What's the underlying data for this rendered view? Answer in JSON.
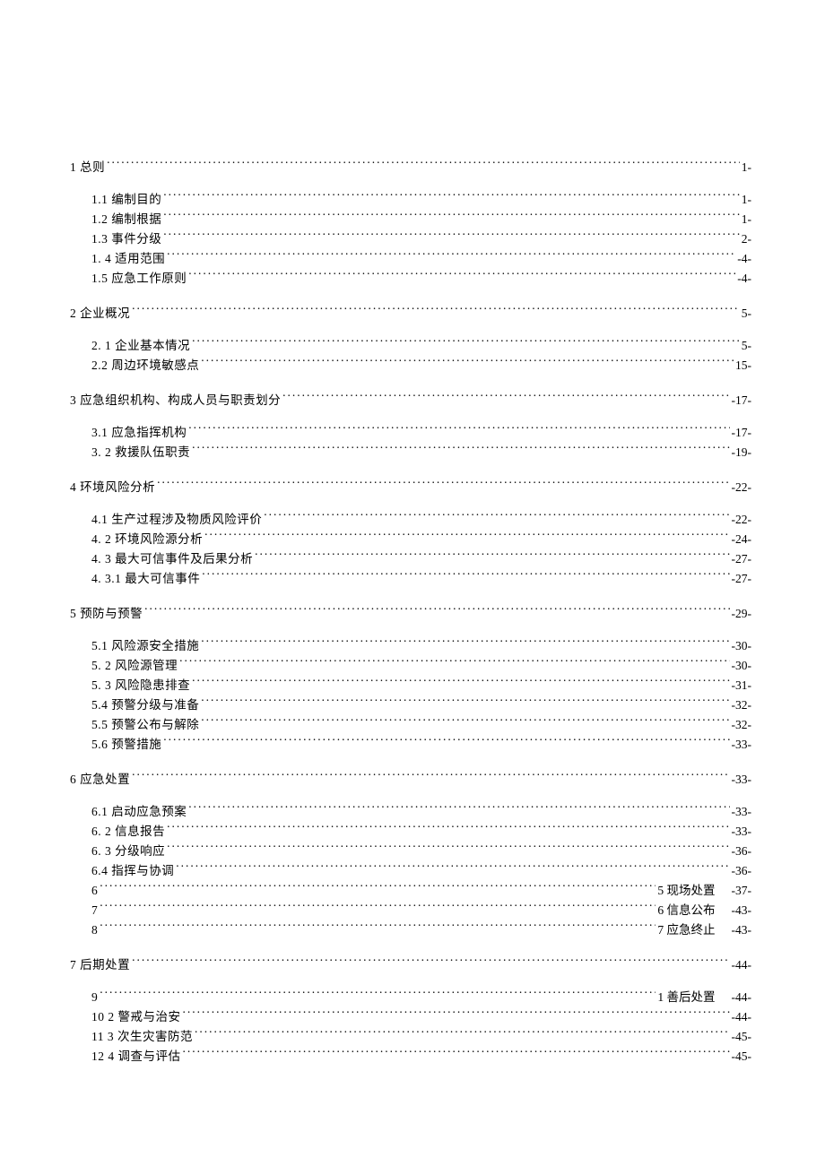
{
  "toc": [
    {
      "head": {
        "label": "1 总则",
        "page": "1-"
      },
      "items": [
        {
          "label": "1.1 编制目的",
          "page": "1-"
        },
        {
          "label": "1.2  编制根据",
          "page": "1-"
        },
        {
          "label": "1.3  事件分级",
          "page": "2-"
        },
        {
          "label": "1. 4 适用范围",
          "page": "-4-"
        },
        {
          "label": "1.5 应急工作原则",
          "page": "-4-"
        }
      ]
    },
    {
      "head": {
        "label": "2    企业概况",
        "page": "5-"
      },
      "items": [
        {
          "label": "2. 1 企业基本情况",
          "page": "5-"
        },
        {
          "label": "2.2 周边环境敏感点",
          "page": "15-"
        }
      ]
    },
    {
      "head": {
        "label": "3    应急组织机构、构成人员与职责划分",
        "page": "-17-"
      },
      "items": [
        {
          "label": "3.1  应急指挥机构",
          "page": "-17-"
        },
        {
          "label": "3. 2 救援队伍职责",
          "page": "-19-"
        }
      ]
    },
    {
      "head": {
        "label": "4    环境风险分析",
        "page": "-22-"
      },
      "items": [
        {
          "label": "4.1  生产过程涉及物质风险评价",
          "page": "-22-"
        },
        {
          "label": "4. 2 环境风险源分析",
          "page": "-24-"
        },
        {
          "label": "4. 3 最大可信事件及后果分析",
          "page": "-27-"
        },
        {
          "label": "4. 3.1 最大可信事件",
          "page": "-27-"
        }
      ]
    },
    {
      "head": {
        "label": "5    预防与预警",
        "page": "-29-"
      },
      "items": [
        {
          "label": "5.1  风险源安全措施",
          "page": "-30-"
        },
        {
          "label": "5. 2 风险源管理",
          "page": "-30-"
        },
        {
          "label": "5. 3 风险隐患排查",
          "page": "-31-"
        },
        {
          "label": "5.4  预警分级与准备",
          "page": "-32-"
        },
        {
          "label": "5.5  预警公布与解除",
          "page": "-32-"
        },
        {
          "label": "5.6  预警措施",
          "page": "-33-"
        }
      ]
    },
    {
      "head": {
        "label": "6 应急处置",
        "page": "-33-"
      },
      "items": [
        {
          "label": "6.1 启动应急预案",
          "page": "-33-"
        },
        {
          "label": "6. 2 信息报告",
          "page": "-33-"
        },
        {
          "label": "6. 3 分级响应",
          "page": "-36-"
        },
        {
          "label": "6.4 指挥与协调",
          "page": "-36-"
        },
        {
          "label": "6",
          "page": "5 现场处置",
          "trail": "-37-"
        },
        {
          "label": "7",
          "page": "6 信息公布",
          "trail": "-43-"
        },
        {
          "label": "8",
          "page": "7 应急终止",
          "trail": "-43-"
        }
      ]
    },
    {
      "head": {
        "label": "7    后期处置",
        "page": "-44-"
      },
      "items": [
        {
          "label": "9",
          "page": "1 善后处置",
          "trail": "-44-"
        },
        {
          "label": "10 2 警戒与治安",
          "page": "-44-"
        },
        {
          "label": "11 3 次生灾害防范",
          "page": "-45-"
        },
        {
          "label": "12 4 调查与评估",
          "page": "-45-"
        }
      ]
    }
  ]
}
